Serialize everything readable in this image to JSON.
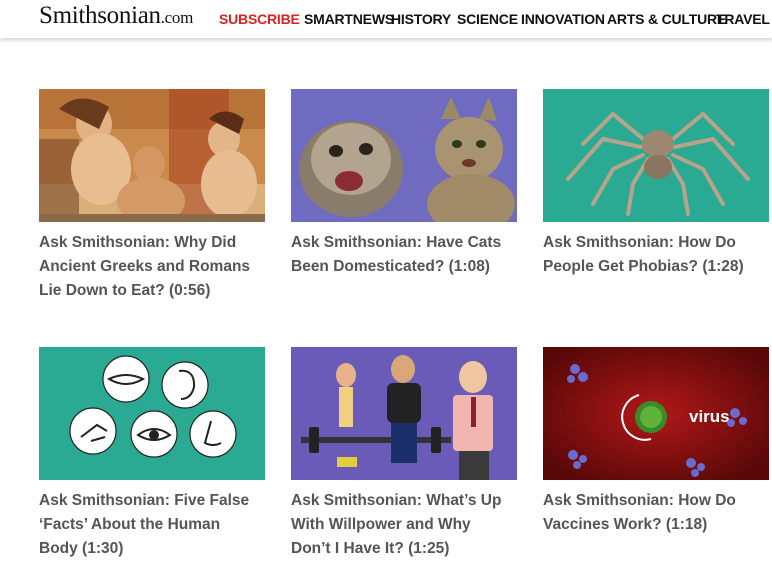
{
  "header": {
    "logo": "Smithsonian",
    "logo_suffix": ".com",
    "nav": [
      "SUBSCRIBE",
      "SMARTNEWS",
      "HISTORY",
      "SCIENCE",
      "INNOVATION",
      "ARTS & CULTURE",
      "TRAVEL"
    ]
  },
  "videos": [
    {
      "title_lines": [
        "Ask Smithsonian: Why Did",
        "Ancient Greeks and Romans",
        "Lie Down to Eat? (0:56)"
      ]
    },
    {
      "title_lines": [
        "Ask Smithsonian: Have Cats",
        "Been Domesticated? (1:08)"
      ]
    },
    {
      "title_lines": [
        "Ask Smithsonian: How Do",
        "People Get Phobias? (1:28)"
      ]
    },
    {
      "title_lines": [
        "Ask Smithsonian: Five False",
        "‘Facts’ About the Human",
        "Body (1:30)"
      ]
    },
    {
      "title_lines": [
        "Ask Smithsonian: What’s Up",
        "With Willpower and Why",
        "Don’t I Have It? (1:25)"
      ]
    },
    {
      "title_lines": [
        "Ask Smithsonian: How Do",
        "Vaccines Work? (1:18)"
      ],
      "thumb_text": "virus"
    }
  ],
  "colors": {
    "accent": "#d8231f",
    "title_text": "#555555",
    "teal": "#2aa993"
  }
}
